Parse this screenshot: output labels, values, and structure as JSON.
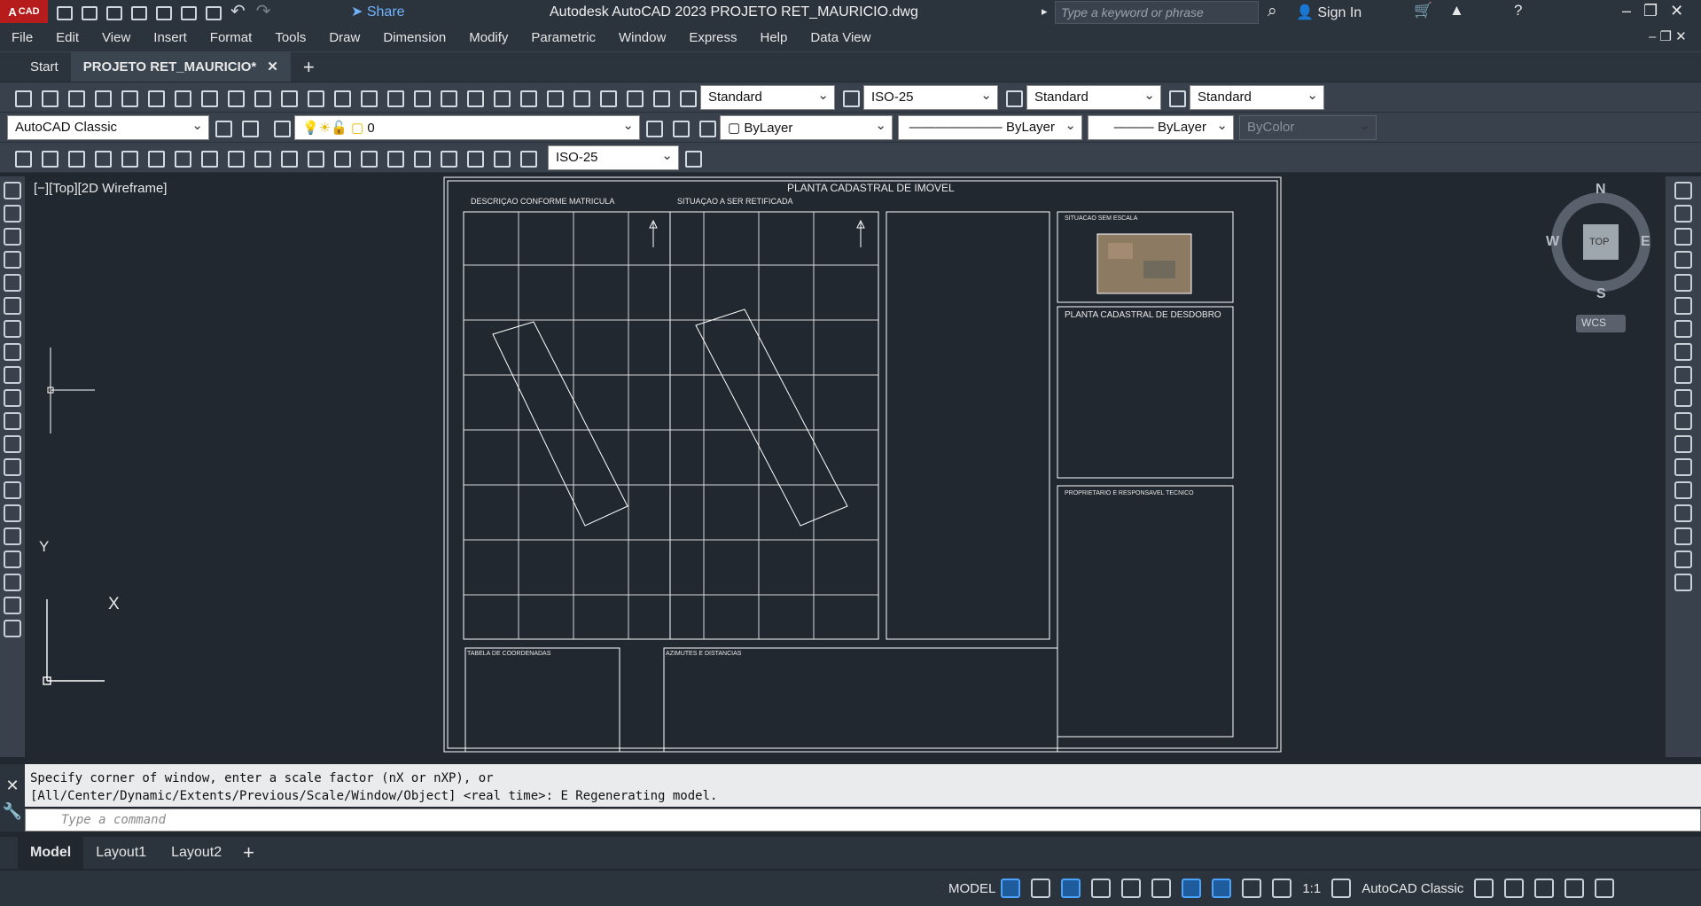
{
  "titlebar": {
    "logo_text": "A",
    "logo_sub": "CAD",
    "share_label": "Share",
    "app_title": "Autodesk AutoCAD 2023    PROJETO RET_MAURICIO.dwg",
    "search_placeholder": "Type a keyword or phrase",
    "signin_label": "Sign In"
  },
  "menubar": {
    "items": [
      "File",
      "Edit",
      "View",
      "Insert",
      "Format",
      "Tools",
      "Draw",
      "Dimension",
      "Modify",
      "Parametric",
      "Window",
      "Express",
      "Help",
      "Data View"
    ]
  },
  "file_tabs": {
    "items": [
      {
        "label": "Start"
      },
      {
        "label": "PROJETO RET_MAURICIO*"
      }
    ]
  },
  "toolbars": {
    "text_style": "Standard",
    "dim_style": "ISO-25",
    "table_style": "Standard",
    "mleader_style": "Standard",
    "workspace": "AutoCAD Classic",
    "layer": "0",
    "color": "ByLayer",
    "linetype": "ByLayer",
    "lineweight": "ByLayer",
    "plot_style": "ByColor",
    "dim_style_2": "ISO-25"
  },
  "viewport": {
    "label": "[−][Top][2D Wireframe]",
    "viewcube": {
      "n": "N",
      "s": "S",
      "e": "E",
      "w": "W",
      "face": "TOP",
      "ucs": "WCS"
    },
    "ucs_y": "Y",
    "ucs_x": "X"
  },
  "drawing": {
    "sheet_title": "PLANTA CADASTRAL DE IMOVEL",
    "panel1_title": "DESCRIÇAO CONFORME MATRICULA",
    "panel2_title": "SITUAÇAO A SER RETIFICADA",
    "situacao_label": "SITUACAO SEM ESCALA",
    "desdobro_title": "PLANTA CADASTRAL DE DESDOBRO",
    "proprietario_title": "PROPRIETARIO E RESPONSAVEL TECNICO",
    "tabela_title": "TABELA DE COORDENADAS",
    "azimutes_title": "AZIMUTES E DISTANCIAS"
  },
  "command": {
    "history_line1": "Specify corner of window, enter a scale factor (nX or nXP), or",
    "history_line2": "[All/Center/Dynamic/Extents/Previous/Scale/Window/Object] <real time>: E Regenerating model.",
    "input_placeholder": "Type a command"
  },
  "layout_tabs": {
    "items": [
      {
        "label": "Model"
      },
      {
        "label": "Layout1"
      },
      {
        "label": "Layout2"
      }
    ]
  },
  "statusbar": {
    "mode": "MODEL",
    "scale": "1:1",
    "workspace": "AutoCAD Classic"
  },
  "colors": {
    "accent": "#4aa3ff",
    "logo": "#b71c1c",
    "background": "#212830"
  }
}
